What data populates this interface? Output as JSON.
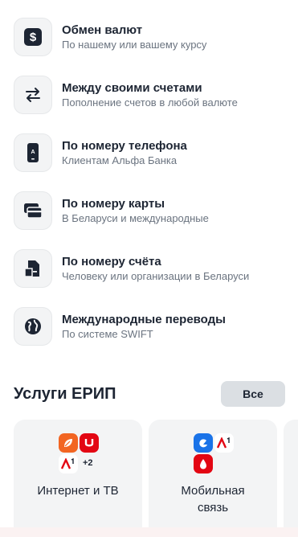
{
  "transfers": [
    {
      "title": "Обмен валют",
      "subtitle": "По нашему или вашему курсу",
      "icon": "dollar-icon"
    },
    {
      "title": "Между своими счетами",
      "subtitle": "Пополнение счетов в любой валюте",
      "icon": "swap-arrows-icon"
    },
    {
      "title": "По номеру телефона",
      "subtitle": "Клиентам Альфа Банка",
      "icon": "phone-icon"
    },
    {
      "title": "По номеру карты",
      "subtitle": "В Беларуси и международные",
      "icon": "card-icon"
    },
    {
      "title": "По номеру счёта",
      "subtitle": "Человеку или организации в Беларуси",
      "icon": "document-icon"
    },
    {
      "title": "Международные переводы",
      "subtitle": "По системе SWIFT",
      "icon": "globe-icon"
    }
  ],
  "erip": {
    "title": "Услуги ЕРИП",
    "all_label": "Все",
    "cards": [
      {
        "label_line1": "Интернет и ТВ",
        "label_line2": "",
        "extra_count": "+2",
        "logos": [
          "orange-leaf-logo",
          "red-u-logo",
          "a1-logo"
        ]
      },
      {
        "label_line1": "Мобильная",
        "label_line2": "связь",
        "extra_count": "",
        "logos": [
          "blue-life-logo",
          "a1-logo",
          "red-mts-logo"
        ]
      }
    ]
  },
  "colors": {
    "text": "#1d2533",
    "subtext": "#6b7480",
    "tile": "#f3f4f5",
    "button": "#dbdfe3",
    "a1_red": "#e30613",
    "life_blue": "#1a73e8",
    "orange": "#f26522"
  }
}
